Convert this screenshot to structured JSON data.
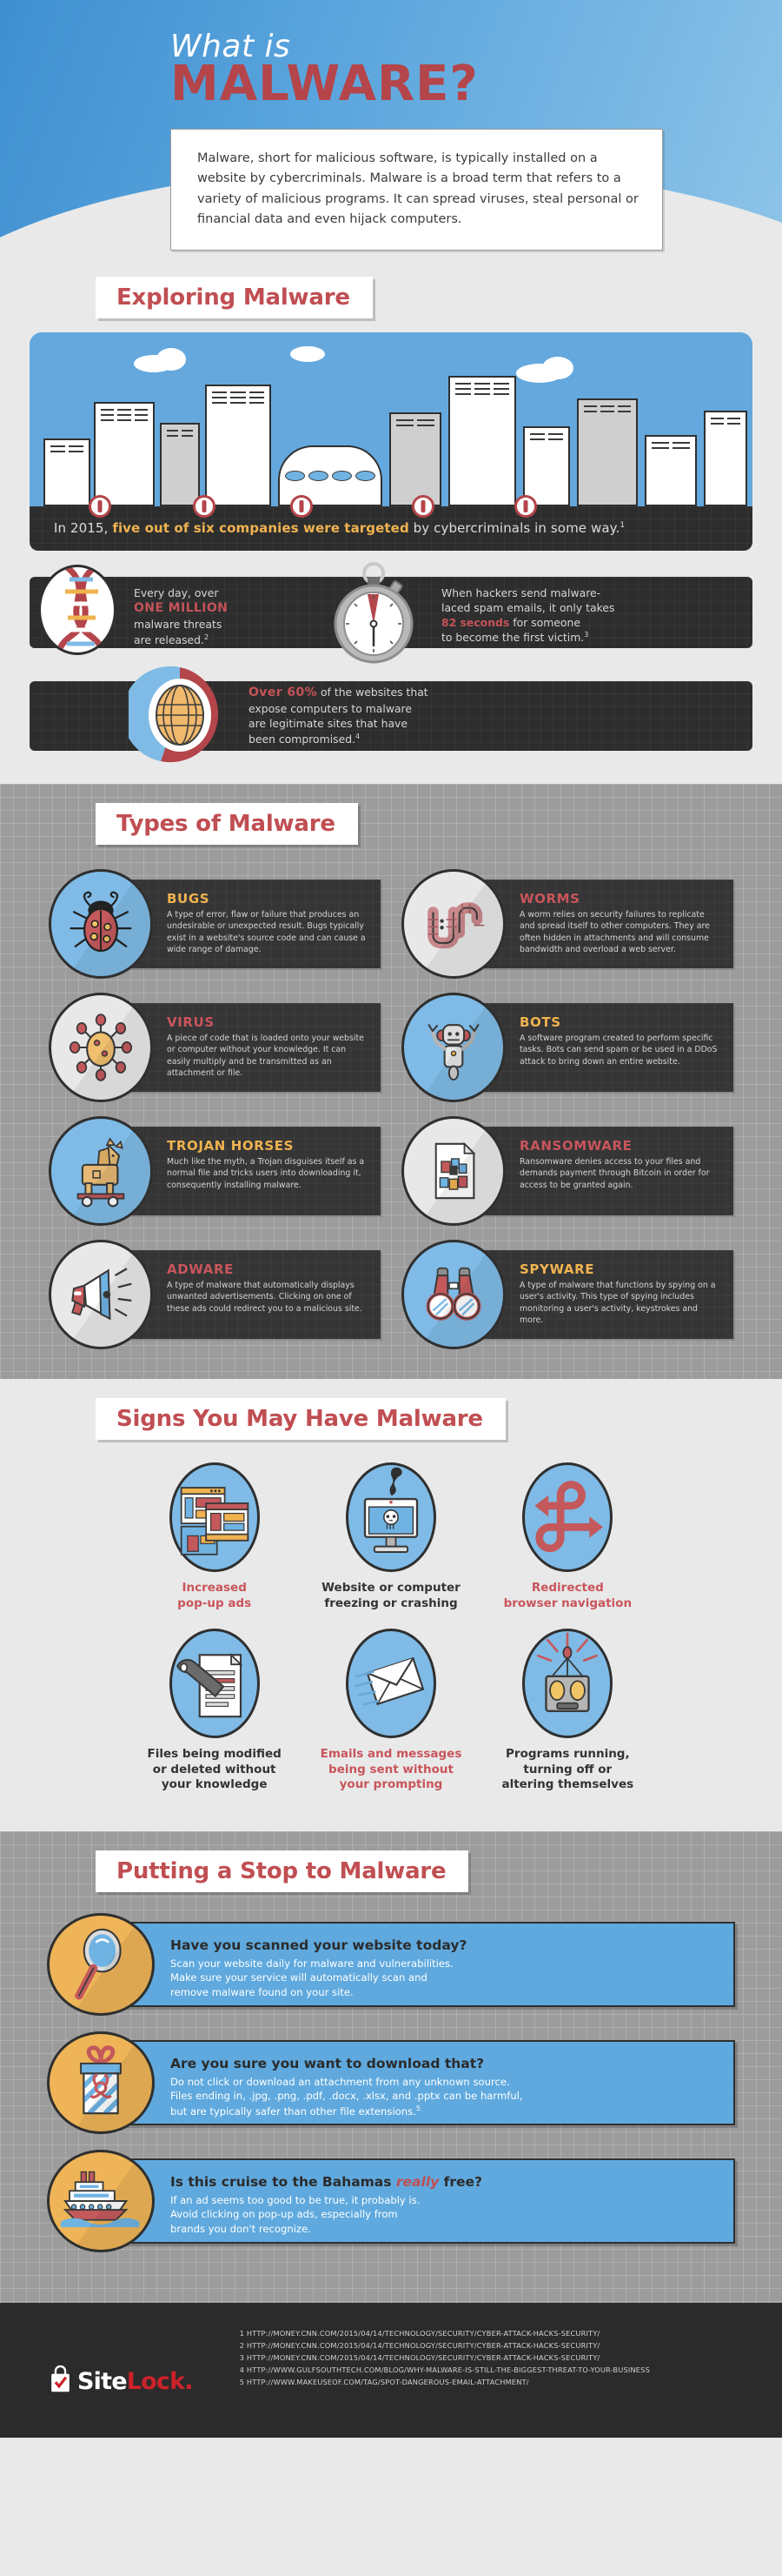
{
  "hero": {
    "eyebrow": "What is",
    "title": "MALWARE?",
    "intro": "Malware, short for malicious software, is typically installed on a website by cybercriminals. Malware is a broad term that refers to a variety of malicious programs. It can spread viruses, steal personal or financial data and even hijack computers."
  },
  "colors": {
    "brand_red": "#b4454a",
    "accent_red": "#c9555c",
    "accent_orange": "#f0b350",
    "sky_blue": "#64a8dd",
    "panel_dark": "#353535",
    "page_gray": "#e9e9e9"
  },
  "sections": {
    "exploring": {
      "title": "Exploring Malware"
    },
    "types": {
      "title": "Types of Malware"
    },
    "signs": {
      "title": "Signs You May Have Malware"
    },
    "stop": {
      "title": "Putting a Stop to Malware"
    }
  },
  "exploring": {
    "city_strip": {
      "pre": "In 2015, ",
      "highlight": "five out of six companies were targeted",
      "post": " by cybercriminals in some way.",
      "ref": "1"
    },
    "stats": [
      {
        "icon": "dna-icon",
        "pre": "Every day, over ",
        "highlight": "ONE MILLION",
        "post": " malware threats are released.",
        "ref": "2",
        "line1": "Every day, over",
        "line2": "ONE MILLION",
        "line3": "malware threats",
        "line4": "are released."
      },
      {
        "icon": "stopwatch-icon",
        "line1": "When hackers send malware-",
        "line2": "laced spam emails, it only takes",
        "highlight": "82 seconds",
        "line3a": " for someone",
        "line4": "to become the first victim.",
        "ref": "3"
      }
    ],
    "donut_stat": {
      "icon": "globe-donut-icon",
      "highlight": "Over 60%",
      "line1": " of the websites that",
      "line2": "expose computers to malware",
      "line3": "are legitimate sites that have",
      "line4": "been compromised.",
      "ref": "4"
    }
  },
  "types": [
    {
      "name": "BUGS",
      "name_color": "orange",
      "icon": "ladybug-icon",
      "icon_bg": "blue",
      "desc": "A type of error, flaw or failure that produces an undesirable or unexpected result. Bugs typically exist in a website's source code and can cause a wide range of damage."
    },
    {
      "name": "WORMS",
      "name_color": "red",
      "icon": "worm-icon",
      "icon_bg": "white",
      "desc": "A worm relies on security failures to replicate and spread itself to other computers. They are often hidden in attachments and will consume bandwidth and overload a web server."
    },
    {
      "name": "VIRUS",
      "name_color": "red",
      "icon": "virus-icon",
      "icon_bg": "white",
      "desc": "A piece of code that is loaded onto your website or computer without your knowledge. It can easily multiply and be transmitted as an attachment or file."
    },
    {
      "name": "BOTS",
      "name_color": "orange",
      "icon": "robot-icon",
      "icon_bg": "blue",
      "desc": "A software program created to perform specific tasks. Bots can send spam or be used in a DDoS attack to bring down an entire website."
    },
    {
      "name": "TROJAN HORSES",
      "name_color": "orange",
      "icon": "trojan-horse-icon",
      "icon_bg": "blue",
      "desc": "Much like the myth, a Trojan disguises itself as a normal file and tricks users into downloading it, consequently installing malware."
    },
    {
      "name": "RANSOMWARE",
      "name_color": "red",
      "icon": "locked-document-icon",
      "icon_bg": "white",
      "desc": "Ransomware denies access to your files and demands payment  through Bitcoin in order for access to be granted again."
    },
    {
      "name": "ADWARE",
      "name_color": "red",
      "icon": "megaphone-icon",
      "icon_bg": "white",
      "desc": "A type of malware that automatically displays unwanted advertisements. Clicking on one of these ads could redirect you to a malicious site."
    },
    {
      "name": "SPYWARE",
      "name_color": "orange",
      "icon": "binoculars-icon",
      "icon_bg": "blue",
      "desc": "A type of malware that functions by spying on a user's activity. This type of spying includes monitoring a user's activity, keystrokes and more."
    }
  ],
  "signs": [
    {
      "icon": "popup-windows-icon",
      "label": "Increased\npop-up ads",
      "color": "red"
    },
    {
      "icon": "crashing-monitor-icon",
      "label": "Website or computer\nfreezing or crashing",
      "color": "dark"
    },
    {
      "icon": "redirect-arrows-icon",
      "label": "Redirected\nbrowser navigation",
      "color": "red"
    },
    {
      "icon": "wrench-document-icon",
      "label": "Files being modified\nor deleted without\nyour knowledge",
      "color": "dark"
    },
    {
      "icon": "envelope-icon",
      "label": "Emails and messages\nbeing sent without\nyour prompting",
      "color": "red"
    },
    {
      "icon": "alarm-robot-icon",
      "label": "Programs running,\nturning off or\naltering themselves",
      "color": "dark"
    }
  ],
  "stop": [
    {
      "icon": "magnifying-glass-icon",
      "head": "Have you scanned your website today?",
      "body_lines": [
        "Scan your website daily for malware and vulnerabilities.",
        "Make sure your service will automatically scan and",
        "remove malware found on your site."
      ]
    },
    {
      "icon": "gift-box-icon",
      "head": "Are you sure you want to download that?",
      "body_lines": [
        "Do not click or download an attachment from any unknown source.",
        "Files ending in, .jpg, .png, .pdf, .docx, .xlsx, and .pptx can be harmful,",
        "but are typically safer than other file extensions."
      ],
      "ref": "5"
    },
    {
      "icon": "cruise-ship-icon",
      "head_pre": "Is this cruise to the Bahamas ",
      "head_em": "really",
      "head_post": " free?",
      "head": "Is this cruise to the Bahamas really free?",
      "body_lines": [
        "If an ad seems too good to be true, it probably is.",
        "Avoid clicking on pop-up ads, especially from",
        "brands you don't recognize."
      ]
    }
  ],
  "footer": {
    "logo": {
      "icon": "sitelock-shield-icon",
      "site": "Site",
      "lock": "Lock."
    },
    "sources": [
      "1 HTTP://MONEY.CNN.COM/2015/04/14/TECHNOLOGY/SECURITY/CYBER-ATTACK-HACKS-SECURITY/",
      "2 HTTP://MONEY.CNN.COM/2015/04/14/TECHNOLOGY/SECURITY/CYBER-ATTACK-HACKS-SECURITY/",
      "3 HTTP://MONEY.CNN.COM/2015/04/14/TECHNOLOGY/SECURITY/CYBER-ATTACK-HACKS-SECURITY/",
      "4 HTTP://WWW.GULFSOUTHTECH.COM/BLOG/WHY-MALWARE-IS-STILL-THE-BIGGEST-THREAT-TO-YOUR-BUSINESS",
      "5 HTTP://WWW.MAKEUSEOF.COM/TAG/SPOT-DANGEROUS-EMAIL-ATTACHMENT/"
    ]
  }
}
